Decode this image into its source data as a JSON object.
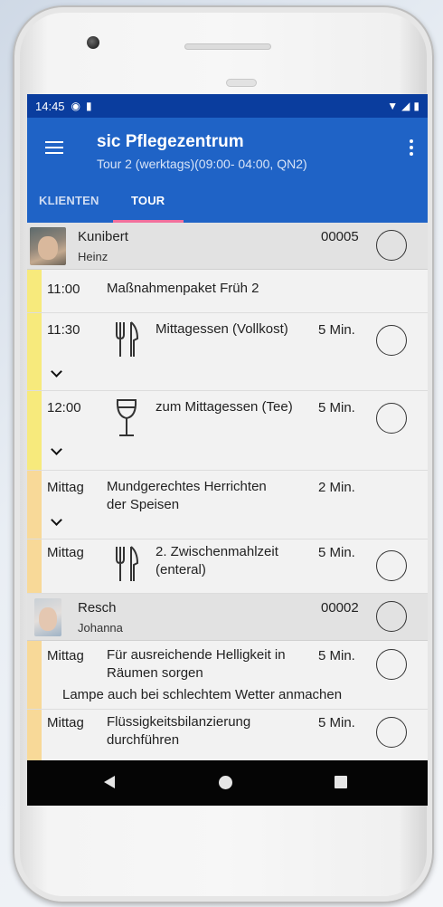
{
  "status_bar": {
    "time": "14:45",
    "icons": [
      "sync-icon",
      "sim-icon"
    ],
    "right_icons": [
      "wifi-icon",
      "signal-icon",
      "battery-icon"
    ]
  },
  "app_bar": {
    "title": "sic Pflegezentrum",
    "subtitle": "Tour 2 (werktags)(09:00- 04:00, QN2)"
  },
  "tabs": [
    {
      "label": "KLIENTEN",
      "active": false
    },
    {
      "label": "TOUR",
      "active": true
    }
  ],
  "clients": [
    {
      "last_name": "Kunibert",
      "first_name": "Heinz",
      "number": "00005",
      "tasks": [
        {
          "time": "11:00",
          "text": "Maßnahmenpaket Früh 2",
          "duration": "",
          "icon": "",
          "bar": "#f7ea7c"
        },
        {
          "time": "11:30",
          "text": "Mittagessen (Vollkost)",
          "duration": "5 Min.",
          "icon": "cutlery-icon",
          "bar": "#f7ea7c"
        },
        {
          "time": "12:00",
          "text": "zum Mittagessen (Tee)",
          "duration": "5 Min.",
          "icon": "wine-glass-icon",
          "bar": "#f7ea7c"
        },
        {
          "time": "Mittag",
          "text_line1": "Mundgerechtes Herrichten",
          "text_line2": "der Speisen",
          "duration": "2 Min.",
          "icon": "",
          "bar": "#f8d998"
        },
        {
          "time": "Mittag",
          "text_line1": "2. Zwischenmahlzeit",
          "text_line2": "(enteral)",
          "duration": "5 Min.",
          "icon": "cutlery-icon",
          "bar": "#f8d998"
        }
      ]
    },
    {
      "last_name": "Resch",
      "first_name": "Johanna",
      "number": "00002",
      "tasks": [
        {
          "time": "Mittag",
          "text_line1": "Für ausreichende Helligkeit in",
          "text_line2": "Räumen sorgen",
          "duration": "5 Min.",
          "note": "Lampe auch bei schlechtem Wetter anmachen",
          "bar": "#f8d998"
        },
        {
          "time": "Mittag",
          "text_line1": "Flüssigkeitsbilanzierung",
          "text_line2": "durchführen",
          "duration": "5 Min.",
          "bar": "#f8d998"
        }
      ]
    }
  ],
  "nav_bar": {
    "buttons": [
      "back-icon",
      "home-icon",
      "recents-icon"
    ]
  },
  "colors": {
    "status_bar": "#0a3d9e",
    "app_bar": "#1f63c6",
    "tab_indicator": "#f2709d",
    "bar_yellow": "#f7ea7c",
    "bar_orange": "#f8d998"
  }
}
